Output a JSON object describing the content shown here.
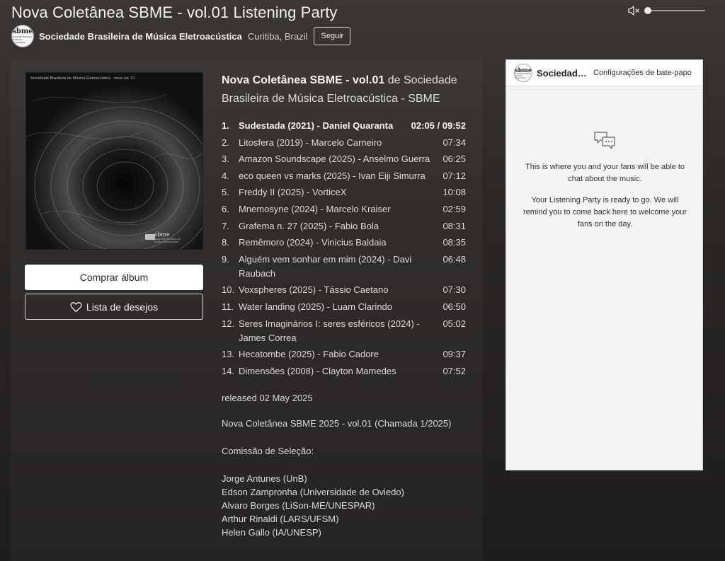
{
  "page": {
    "title": "Nova Coletânea SBME - vol.01 Listening Party"
  },
  "artist": {
    "avatar_text": "sbme",
    "avatar_subtext": "Sociedade Brasileira de Música Eletroacústica",
    "name": "Sociedade Brasileira de Música Eletroacústica",
    "location": "Curitiba, Brazil",
    "follow_label": "Seguir"
  },
  "album": {
    "art_caption": "Sociedade Brasileira de Música Eletroacústica · nova vol. 01",
    "art_logo": "sbme",
    "title": "Nova Coletânea SBME - vol.01",
    "by_word": "de",
    "artist_line": "Sociedade Brasileira de Música Eletroacústica - SBME",
    "buy_label": "Comprar álbum",
    "wishlist_label": "Lista de desejos",
    "tracks": [
      {
        "num": "1.",
        "title": "Sudestada (2021) - Daniel Quaranta",
        "duration": "02:05 / 09:52",
        "active": true
      },
      {
        "num": "2.",
        "title": "Litosfera (2019) - Marcelo Carneiro",
        "duration": "07:34"
      },
      {
        "num": "3.",
        "title": "Amazon Soundscape (2025) - Anselmo Guerra",
        "duration": "06:25"
      },
      {
        "num": "4.",
        "title": "eco queen vs marks (2025) - Ivan Eiji Simurra",
        "duration": "07:12"
      },
      {
        "num": "5.",
        "title": "Freddy II (2025) - VorticeX",
        "duration": "10:08"
      },
      {
        "num": "6.",
        "title": "Mnemosyne (2024) - Marcelo Kraiser",
        "duration": "02:59"
      },
      {
        "num": "7.",
        "title": "Grafema n. 27 (2025) - Fabio Bola",
        "duration": "08:31"
      },
      {
        "num": "8.",
        "title": "Remêmoro (2024) - Vinicius Baldaia",
        "duration": "08:35"
      },
      {
        "num": "9.",
        "title": "Alguém vem sonhar em mim (2024) - Davi Raubach",
        "duration": "06:48"
      },
      {
        "num": "10.",
        "title": "Voxspheres (2025) - Tássio Caetano",
        "duration": "07:30"
      },
      {
        "num": "11.",
        "title": "Water landing (2025) - Luam Clarindo",
        "duration": "06:50"
      },
      {
        "num": "12.",
        "title": "Seres Imaginários I: seres esféricos (2024) - James Correa",
        "duration": "05:02"
      },
      {
        "num": "13.",
        "title": "Hecatombe (2025) - Fabio Cadore",
        "duration": "09:37"
      },
      {
        "num": "14.",
        "title": "Dimensões (2008) - Clayton Mamedes",
        "duration": "07:52"
      }
    ],
    "released": "released 02 May 2025",
    "description_title": "Nova Coletânea SBME 2025 - vol.01 (Chamada 1/2025)",
    "committee_heading": "Comissão de Seleção:",
    "committee": [
      "Jorge Antunes (UnB)",
      "Edson Zampronha (Universidade de Oviedo)",
      "Alvaro Borges (LiSon-ME/UNESPAR)",
      "Arthur Rinaldi (LARS/UFSM)",
      "Helen Gallo (IA/UNESP)"
    ]
  },
  "chat": {
    "name": "Sociedade Brasileira de Música Eletroacústica",
    "settings_label": "Configurações de bate-papo",
    "message_1": "This is where you and your fans will be able to chat about the music.",
    "message_2": "Your Listening Party is ready to go. We will remind you to come back here to welcome your fans on the day."
  },
  "icons": {
    "volume": "speaker-muted-icon",
    "heart": "heart-icon",
    "chat": "chat-bubbles-icon"
  },
  "colors": {
    "background": "#2b2826",
    "panel": "#302d2b",
    "chat_bg": "#f4f4f4",
    "button_bg": "#ffffff"
  },
  "volume_level": 0
}
